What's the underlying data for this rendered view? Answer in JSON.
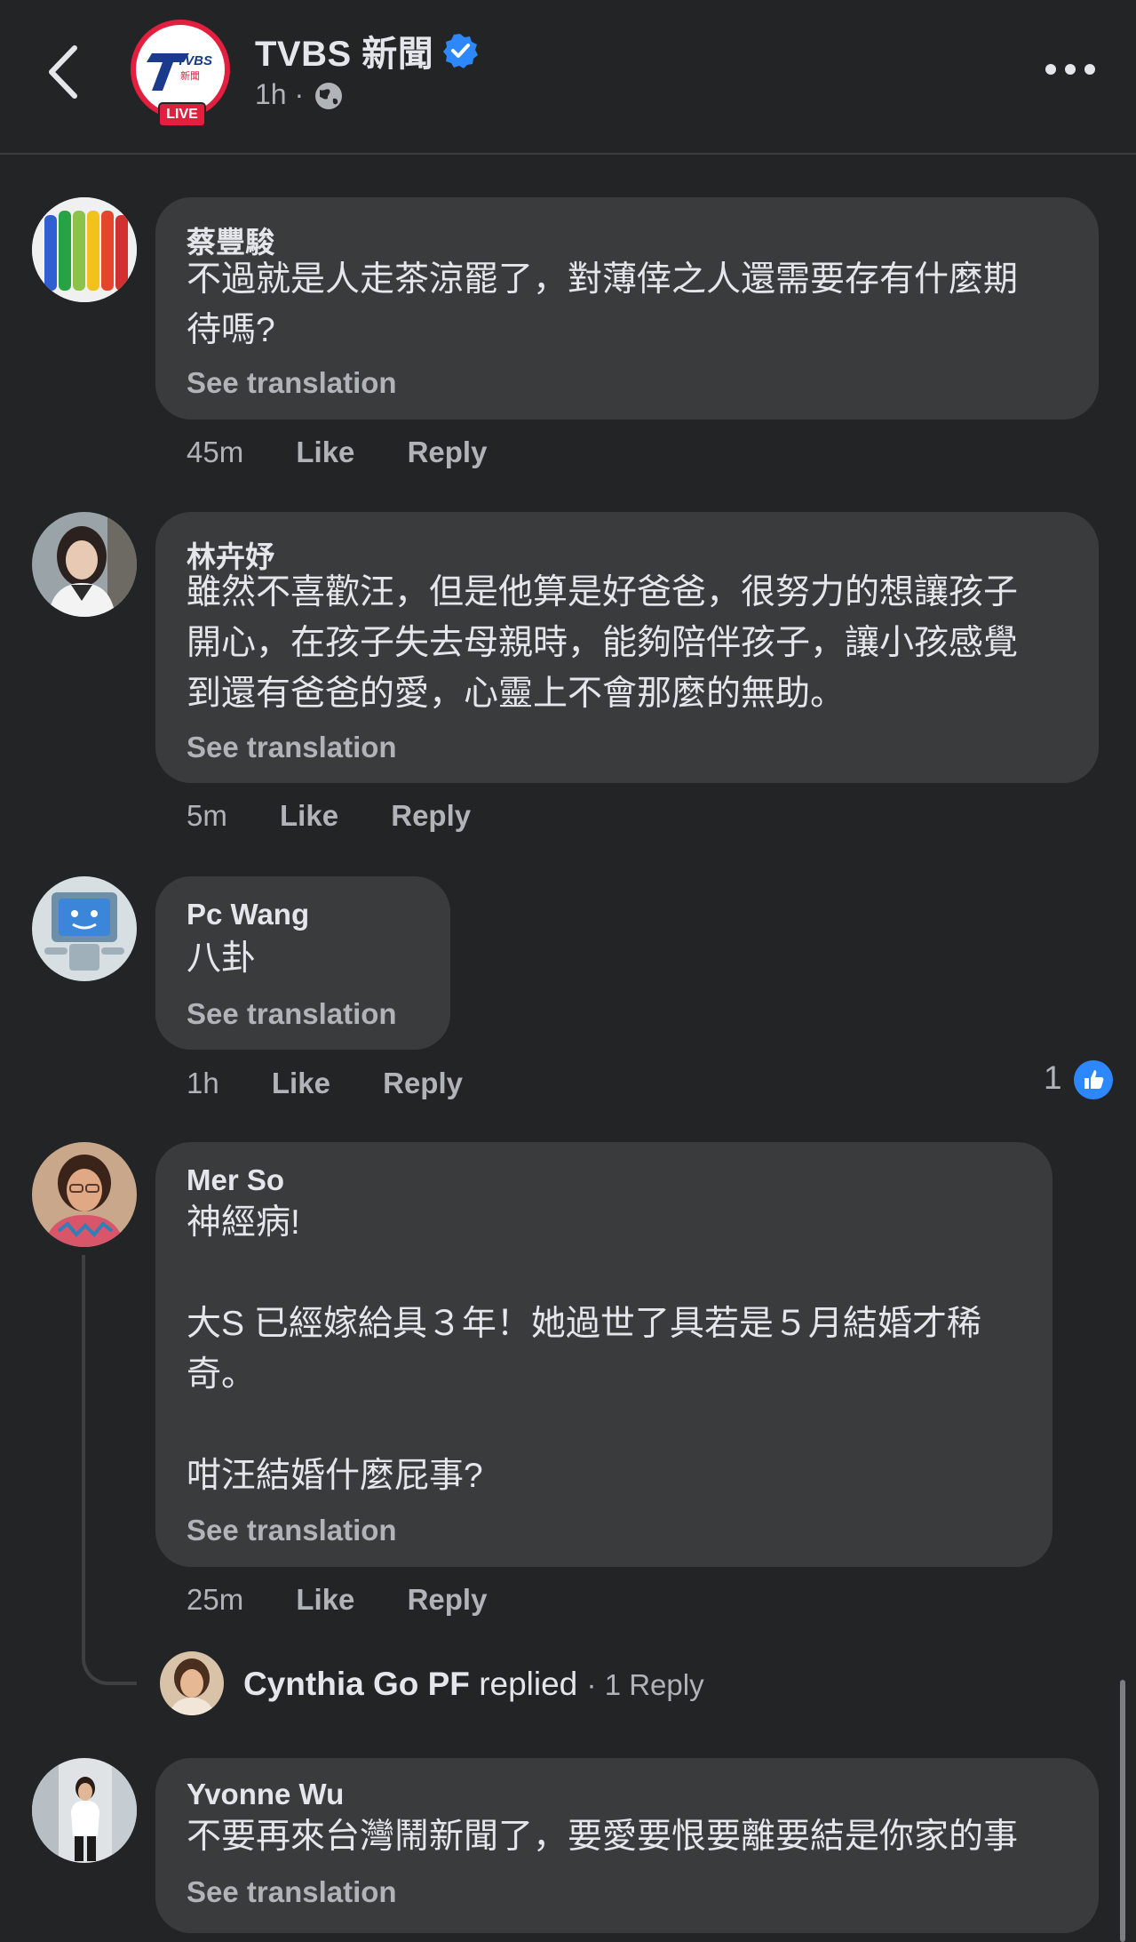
{
  "header": {
    "page_name": "TVBS 新聞",
    "logo_text": "TVBS",
    "logo_subtext": "新聞",
    "live_badge": "LIVE",
    "post_time": "1h ·",
    "icons": [
      "back-arrow-icon",
      "verified-badge-icon",
      "globe-icon",
      "more-options-icon"
    ]
  },
  "comments": [
    {
      "author": "蔡豐駿",
      "text": "不過就是人走茶涼罷了，對薄倖之人還需要存有什麼期\n待嗎?",
      "translate": "See translation",
      "time": "45m",
      "like": "Like",
      "reply": "Reply"
    },
    {
      "author": "林卉妤",
      "text": "雖然不喜歡汪，但是他算是好爸爸，很努力的想讓孩子\n開心，在孩子失去母親時，能夠陪伴孩子，讓小孩感覺\n到還有爸爸的愛，心靈上不會那麼的無助。",
      "translate": "See translation",
      "time": "5m",
      "like": "Like",
      "reply": "Reply"
    },
    {
      "author": "Pc Wang",
      "text": "八卦",
      "translate": "See translation",
      "time": "1h",
      "like": "Like",
      "reply": "Reply",
      "reaction_count": "1"
    },
    {
      "author": "Mer So",
      "text": "神經病!\n\n大S 已經嫁給具３年！她過世了具若是５月結婚才稀\n奇。\n\n咁汪結婚什麼屁事?",
      "translate": "See translation",
      "time": "25m",
      "like": "Like",
      "reply": "Reply",
      "reply_author": "Cynthia Go PF",
      "reply_verb": "replied",
      "reply_count": "· 1 Reply"
    },
    {
      "author": "Yvonne Wu",
      "text": "不要再來台灣鬧新聞了，要愛要恨要離要結是你家的事",
      "translate": "See translation"
    }
  ],
  "colors": {
    "background": "#232426",
    "bubble": "#3a3b3c",
    "text_primary": "#e4e6eb",
    "text_secondary": "#b0b3b8",
    "verified_blue": "#2d88ff",
    "live_red": "#e41e3f"
  }
}
